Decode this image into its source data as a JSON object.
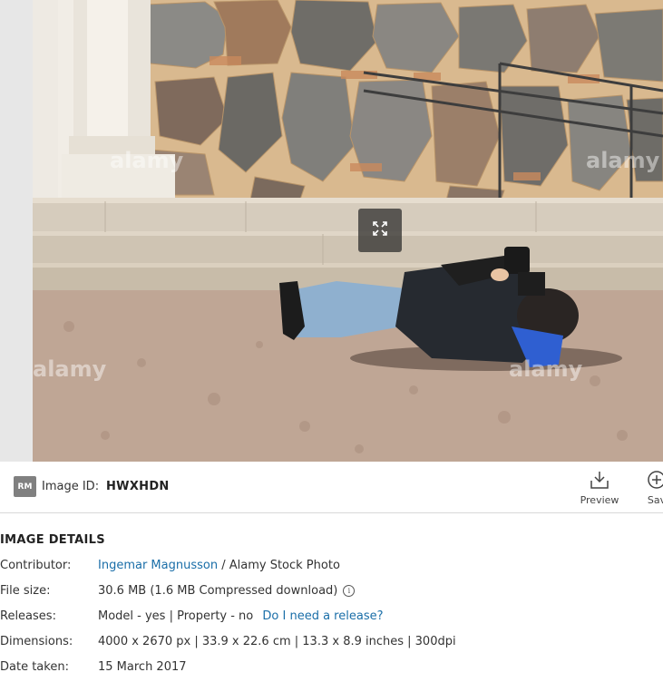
{
  "image_bar": {
    "badge": "RM",
    "id_label": "Image ID:",
    "id_value": "HWXHDN",
    "preview_label": "Preview",
    "save_label": "Sav"
  },
  "watermark": "alamy",
  "details": {
    "heading": "IMAGE DETAILS",
    "rows": {
      "contributor": {
        "key": "Contributor:",
        "name": "Ingemar Magnusson",
        "rest": " / Alamy Stock Photo"
      },
      "file_size": {
        "key": "File size:",
        "value": "30.6 MB (1.6 MB Compressed download)",
        "info_icon": "info-icon"
      },
      "releases": {
        "key": "Releases:",
        "value": "Model - yes | Property - no",
        "link": "Do I need a release?"
      },
      "dimensions": {
        "key": "Dimensions:",
        "value": "4000 x 2670 px | 33.9 x 22.6 cm | 13.3 x 8.9 inches | 300dpi"
      },
      "date_taken": {
        "key": "Date taken:",
        "value": "15 March 2017"
      }
    }
  },
  "icons": {
    "expand": "expand-icon",
    "preview": "download-icon",
    "save": "plus-circle-icon"
  },
  "colors": {
    "link": "#1a6ea8",
    "badge": "#808080"
  }
}
